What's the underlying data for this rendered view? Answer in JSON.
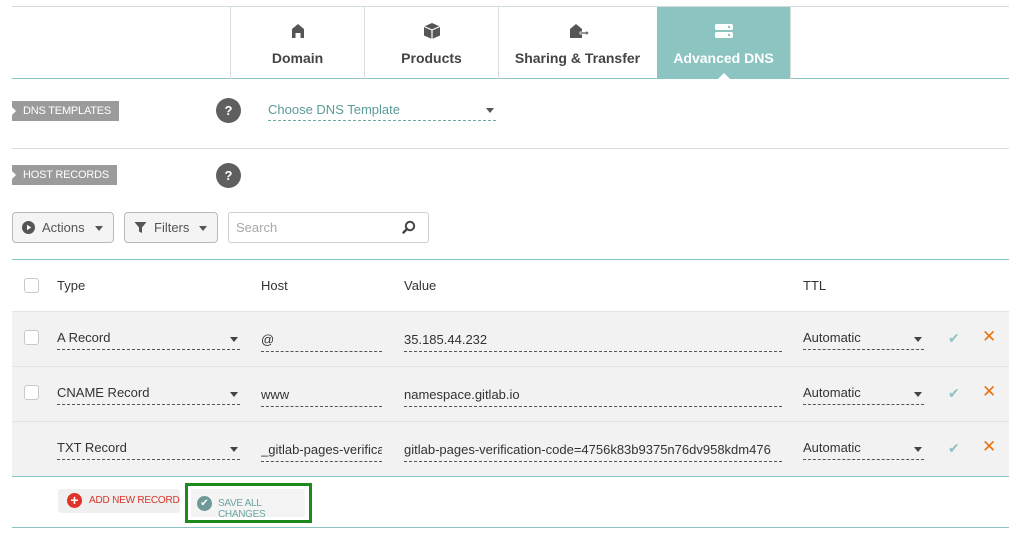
{
  "tabs": [
    {
      "label": "Domain",
      "icon": "home-icon",
      "active": false
    },
    {
      "label": "Products",
      "icon": "box-icon",
      "active": false
    },
    {
      "label": "Sharing & Transfer",
      "icon": "transfer-icon",
      "active": false
    },
    {
      "label": "Advanced DNS",
      "icon": "dns-server-icon",
      "active": true
    }
  ],
  "dns_templates": {
    "tag": "DNS TEMPLATES",
    "help": "?",
    "select_value": "Choose DNS Template"
  },
  "host_records": {
    "tag": "HOST RECORDS",
    "help": "?"
  },
  "toolbar": {
    "actions_label": "Actions",
    "filters_label": "Filters",
    "search_placeholder": "Search"
  },
  "table": {
    "headers": {
      "type": "Type",
      "host": "Host",
      "value": "Value",
      "ttl": "TTL"
    },
    "rows": [
      {
        "type": "A Record",
        "host": "@",
        "value": "35.185.44.232",
        "ttl": "Automatic",
        "checkbox": true
      },
      {
        "type": "CNAME Record",
        "host": "www",
        "value": "namespace.gitlab.io",
        "ttl": "Automatic",
        "checkbox": true
      },
      {
        "type": "TXT Record",
        "host": "_gitlab-pages-verification-code",
        "value": "gitlab-pages-verification-code=4756k83b9375n76dv958kdm476",
        "ttl": "Automatic",
        "checkbox": false
      }
    ]
  },
  "footer": {
    "add_label": "ADD NEW RECORD",
    "save_label": "SAVE ALL CHANGES"
  },
  "colors": {
    "accent": "#8bc4c1",
    "highlight": "#1d8a1d",
    "delete": "#e8730f",
    "add": "#e0342a"
  }
}
